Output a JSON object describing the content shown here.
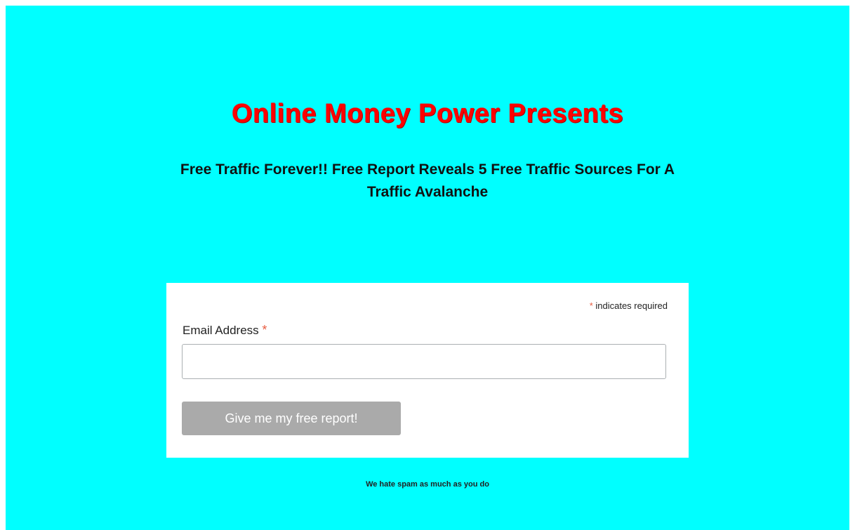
{
  "page": {
    "background_color": "#00ffff",
    "headline": "Online Money Power Presents",
    "headline_color": "#ff0000",
    "subheadline": "Free Traffic Forever!! Free Report Reveals 5 Free Traffic Sources For A Traffic Avalanche"
  },
  "form": {
    "required_marker": "*",
    "required_note": " indicates required",
    "email_label": "Email Address ",
    "email_value": "",
    "email_placeholder": "",
    "submit_label": "Give me my free report!",
    "submit_color": "#aaaaaa"
  },
  "footer": {
    "spam_note": "We hate spam as much as you do"
  }
}
